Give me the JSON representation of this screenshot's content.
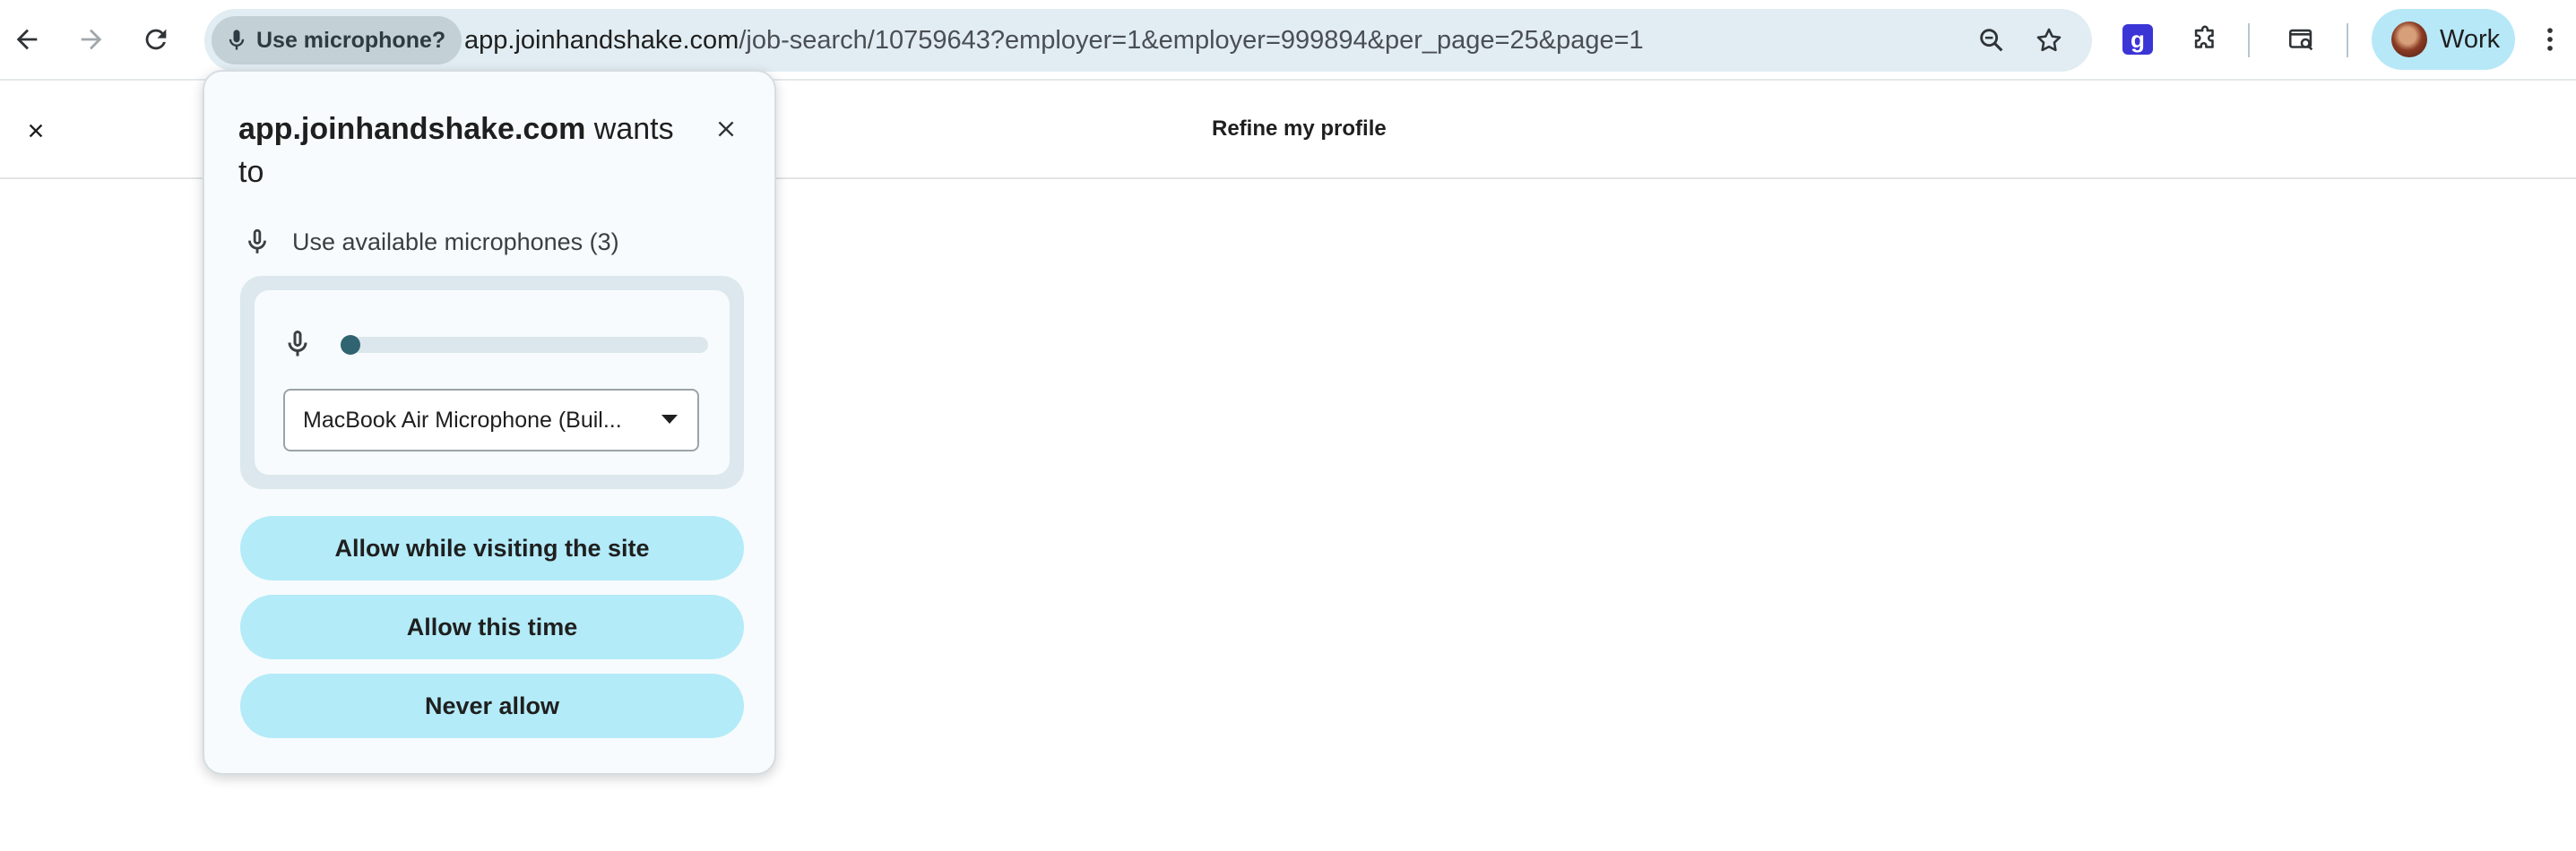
{
  "browser": {
    "omnibox": {
      "permission_chip": "Use microphone?",
      "url_domain": "app.joinhandshake.com",
      "url_path": "/job-search/10759643?employer=1&employer=999894&per_page=25&page=1"
    },
    "extension_label": "g",
    "profile": {
      "label": "Work"
    },
    "icons": {
      "back": "back-arrow-icon",
      "forward": "forward-arrow-icon",
      "reload": "reload-icon",
      "zoom": "zoom-icon",
      "bookmark": "star-icon",
      "extensions": "puzzle-icon",
      "lens": "search-tab-icon",
      "menu": "kebab-menu-icon"
    }
  },
  "page": {
    "title": "Refine my profile"
  },
  "popup": {
    "title_domain": "app.joinhandshake.com",
    "title_rest": " wants to",
    "permission_label": "Use available microphones (3)",
    "mic_level": 0.0,
    "selected_microphone": "MacBook Air Microphone (Buil...",
    "buttons": {
      "allow_visit": "Allow while visiting the site",
      "allow_once": "Allow this time",
      "never": "Never allow"
    }
  },
  "colors": {
    "accent_button": "#b3ebf8",
    "omnibox": "#e1edf2",
    "level_dot": "#2f6470"
  }
}
